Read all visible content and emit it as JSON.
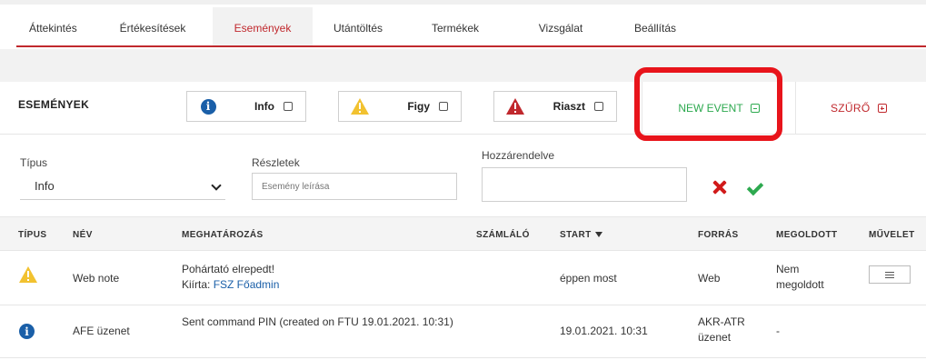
{
  "tabs": [
    {
      "label": "Áttekintés",
      "active": false
    },
    {
      "label": "Értékesítések",
      "active": false
    },
    {
      "label": "Események",
      "active": true
    },
    {
      "label": "Utántöltés",
      "active": false
    },
    {
      "label": "Termékek",
      "active": false
    },
    {
      "label": "Vizsgálat",
      "active": false
    },
    {
      "label": "Beállítás",
      "active": false
    }
  ],
  "toolbar": {
    "title": "ESEMÉNYEK",
    "filters": [
      {
        "label": "Info",
        "icon": "info-icon"
      },
      {
        "label": "Figy",
        "icon": "warning-icon"
      },
      {
        "label": "Riaszt",
        "icon": "alarm-icon"
      }
    ],
    "new_event": "NEW EVENT",
    "filter_toggle": "SZŰRŐ"
  },
  "form": {
    "type_label": "Típus",
    "type_value": "Info",
    "details_label": "Részletek",
    "details_placeholder": "Esemény leírása",
    "assigned_label": "Hozzárendelve"
  },
  "table": {
    "headers": [
      "TÍPUS",
      "NÉV",
      "MEGHATÁROZÁS",
      "SZÁMLÁLÓ",
      "START",
      "FORRÁS",
      "MEGOLDOTT",
      "MŰVELET"
    ],
    "rows": [
      {
        "type_icon": "warning-icon",
        "name": "Web note",
        "desc_line1": "Pohártató elrepedt!",
        "desc_prefix": "Kiírta:",
        "desc_link": "FSZ Főadmin",
        "counter": "",
        "start": "éppen most",
        "source": "Web",
        "resolved": "Nem megoldott"
      },
      {
        "type_icon": "info-icon",
        "name": "AFE üzenet",
        "desc_line1": "Sent command PIN (created on FTU 19.01.2021. 10:31)",
        "counter": "",
        "start": "19.01.2021. 10:31",
        "source": "AKR-ATR üzenet",
        "resolved": "-"
      }
    ]
  },
  "colors": {
    "accent": "#c0282d",
    "green": "#2da94f",
    "info_blue": "#1a5fa8",
    "warning_yellow": "#f2c230",
    "alarm_red": "#c0282d",
    "highlight": "#e8141b"
  }
}
